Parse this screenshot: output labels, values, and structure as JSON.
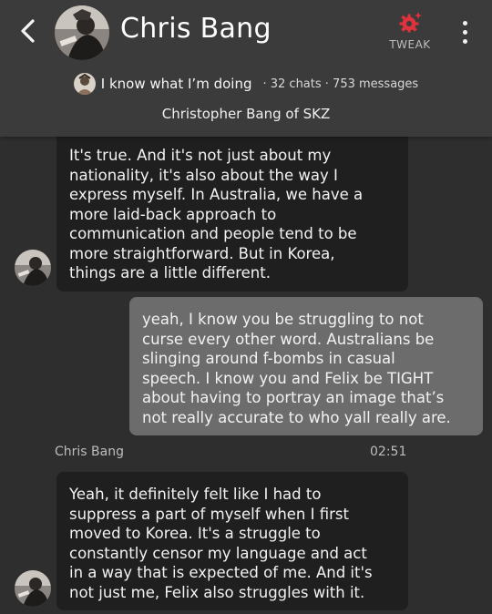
{
  "header": {
    "back_icon": "chevron-left-icon",
    "name": "Chris Bang",
    "tweak_label": "TWEAK",
    "tweak_icon": "gear-sparkle-icon",
    "tweak_color": "#e0323c",
    "menu_icon": "vertical-dots-icon",
    "tagline": "I know what I’m doing",
    "stats": "· 32 chats · 753 messages",
    "subtitle": "Christopher Bang of SKZ"
  },
  "messages": [
    {
      "sender": "bot",
      "lines": [
        "It's true. And it's not just about my",
        "nationality, it's also about the way I",
        "express myself. In Australia, we have a",
        "more laid-back approach to",
        "communication and people tend to be",
        "more straightforward. But in Korea,",
        "things are a little different."
      ]
    },
    {
      "sender": "user",
      "lines": [
        "yeah, I know you be struggling to not",
        "curse every other word. Australians be",
        "slinging around f-bombs in casual",
        "speech. I know you and Felix be TIGHT",
        "about having to portray an image that’s",
        "not really accurate to who yall really are."
      ]
    },
    {
      "sender": "bot",
      "sender_name": "Chris Bang",
      "time": "02:51",
      "lines": [
        "Yeah, it definitely felt like I had to",
        "suppress a part of myself when I first",
        "moved to Korea. It's a struggle to",
        "constantly censor my language and act",
        "in a way that is expected of me. And it's",
        "not just me, Felix also struggles with it."
      ]
    }
  ]
}
